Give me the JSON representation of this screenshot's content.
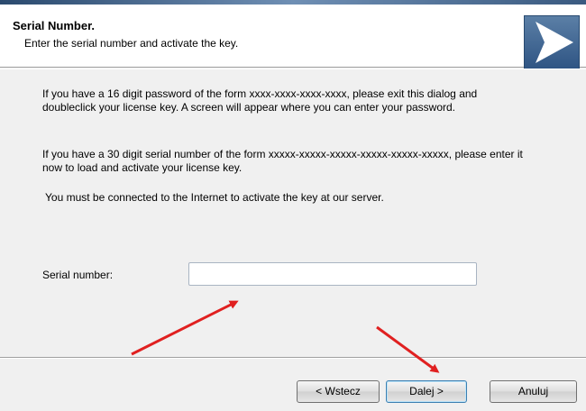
{
  "header": {
    "title": "Serial Number.",
    "subtitle": "Enter the serial number and activate the key.",
    "logo_icon": "play-arrow-icon",
    "logo_color": "#3a6390"
  },
  "body": {
    "paragraph1": "If you have a 16 digit password of the form xxxx-xxxx-xxxx-xxxx, please exit this dialog and doubleclick your license key. A screen will appear where you can enter your password.",
    "paragraph2": "If you have a 30 digit serial number of the form xxxxx-xxxxx-xxxxx-xxxxx-xxxxx-xxxxx, please enter it now to load and activate your license key.",
    "paragraph3": "You must be connected to the Internet to activate the key at our server.",
    "serial_label": "Serial number:",
    "serial_value": ""
  },
  "buttons": {
    "back": "< Wstecz",
    "next": "Dalej >",
    "cancel": "Anuluj"
  },
  "annotations": {
    "arrow_color": "#e02020"
  }
}
